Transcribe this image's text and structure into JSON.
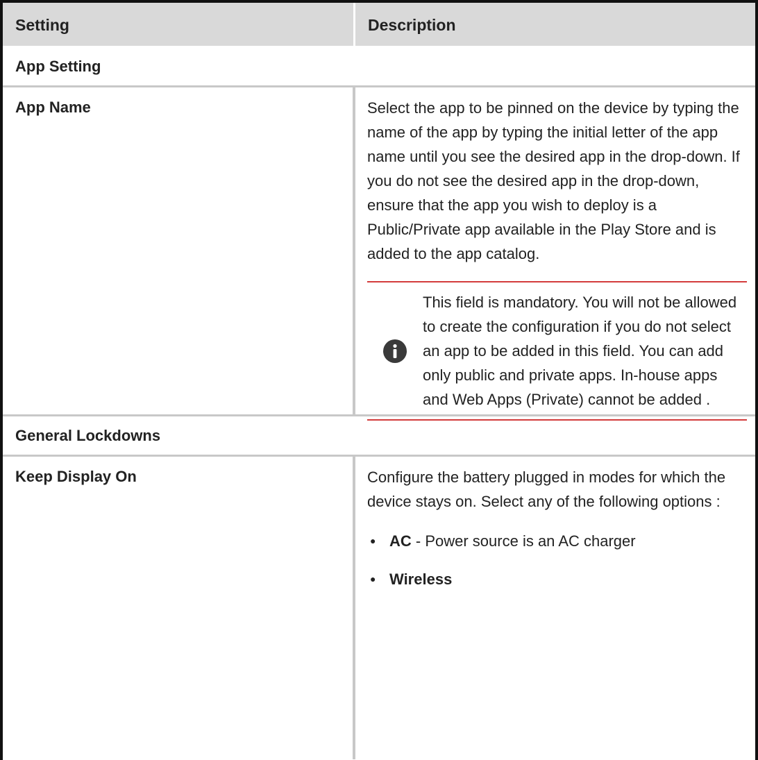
{
  "header": {
    "setting": "Setting",
    "description": "Description"
  },
  "sections": [
    {
      "title": "App Setting",
      "rows": [
        {
          "setting": "App Name",
          "description": "Select the app to be pinned on the device by typing the name of the app by typing the initial letter of the app name until you see the desired app in the drop-down. If you do not see the desired app in the drop-down, ensure that the app you wish to deploy is a Public/Private app available in the Play Store and is added to the app catalog.",
          "note": {
            "icon": "info-icon",
            "text": "This field is mandatory. You will not be allowed to create the configuration if you do not select an app to be added in this field. You can add only public and private apps. In-house apps and Web Apps (Private) cannot be added ."
          }
        }
      ]
    },
    {
      "title": "General Lockdowns",
      "rows": [
        {
          "setting": "Keep Display On",
          "description": "Configure the battery plugged in modes for which the device stays on. Select any of the following options :",
          "options": [
            {
              "name": "AC",
              "text": " - Power source is an AC charger"
            },
            {
              "name": "Wireless",
              "text": ""
            }
          ]
        }
      ]
    }
  ],
  "colors": {
    "header_bg": "#d9d9d9",
    "border": "#c8c8c8",
    "note_rule": "#d33b3b",
    "outer_border": "#111111"
  }
}
